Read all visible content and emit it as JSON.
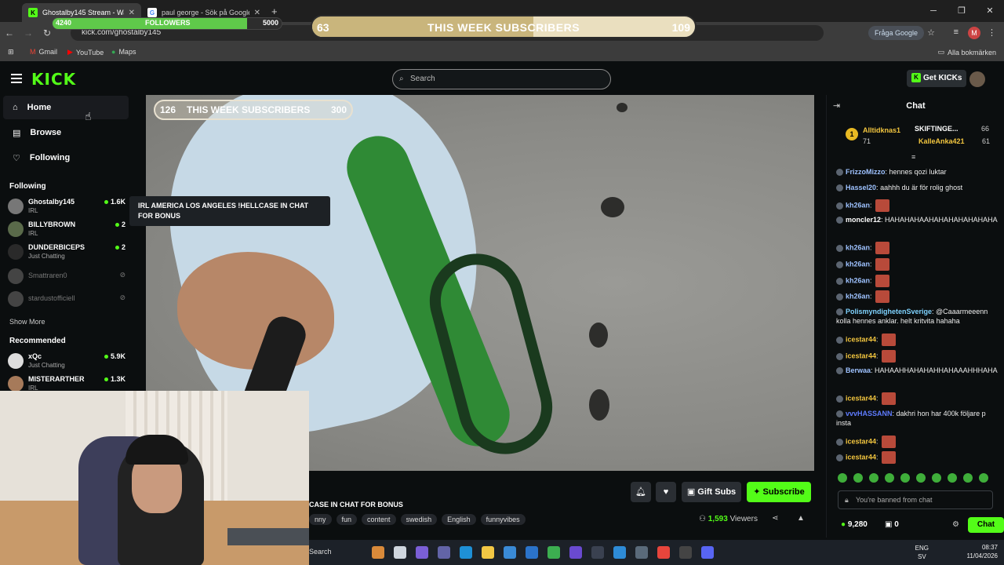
{
  "browser": {
    "tabs": [
      {
        "title": "Ghostalby145 Stream - Wat",
        "active": true
      },
      {
        "title": "paul george - Sök på Google",
        "active": false
      }
    ],
    "url": "kick.com/ghostalby145",
    "ask_google": "Fråga Google",
    "profile_initial": "M",
    "bookmarks": [
      "Gmail",
      "YouTube",
      "Maps"
    ],
    "all_bookmarks": "Alla bokmärken"
  },
  "overlay": {
    "followers": {
      "current": "4240",
      "label": "FOLLOWERS",
      "goal": "5000",
      "progress": 0.848
    },
    "subs_top": {
      "current": "63",
      "label": "THIS WEEK SUBSCRIBERS",
      "goal": "109",
      "progress": 0.578
    },
    "subs_video": {
      "current": "126",
      "label": "THIS WEEK SUBSCRIBERS",
      "goal": "300"
    }
  },
  "header": {
    "logo": "KICK",
    "search_placeholder": "Search",
    "get_kicks": "Get KICKs"
  },
  "sidebar": {
    "nav": [
      {
        "label": "Home",
        "icon": "home-icon"
      },
      {
        "label": "Browse",
        "icon": "browse-icon"
      },
      {
        "label": "Following",
        "icon": "heart-icon"
      }
    ],
    "following_heading": "Following",
    "following": [
      {
        "name": "Ghostalby145",
        "category": "IRL",
        "viewers": "1.6K",
        "live": true
      },
      {
        "name": "BILLYBROWN",
        "category": "IRL",
        "viewers": "2",
        "live": true
      },
      {
        "name": "DUNDERBICEPS",
        "category": "Just Chatting",
        "viewers": "2",
        "live": true
      },
      {
        "name": "Smattraren0",
        "category": "",
        "viewers": "",
        "live": false
      },
      {
        "name": "stardustofficiell",
        "category": "",
        "viewers": "",
        "live": false
      }
    ],
    "show_more": "Show More",
    "recommended_heading": "Recommended",
    "recommended": [
      {
        "name": "xQc",
        "category": "Just Chatting",
        "viewers": "5.9K"
      },
      {
        "name": "MISTERARTHER",
        "category": "IRL",
        "viewers": "1.3K"
      }
    ],
    "tooltip": "IRL AMERICA LOS ANGELES !HELLCASE IN CHAT FOR BONUS"
  },
  "stream": {
    "title_visible": "CASE IN CHAT FOR BONUS",
    "tags": [
      "nny",
      "fun",
      "content",
      "swedish",
      "English",
      "funnyvibes"
    ],
    "gift_subs": "Gift Subs",
    "subscribe": "Subscribe",
    "viewers": "1,593",
    "viewers_label": "Viewers"
  },
  "chat": {
    "title": "Chat",
    "leaderboard": [
      {
        "rank": "1",
        "name": "Alltidknas1",
        "value": "71"
      },
      {
        "name": "SKIFTINGE...",
        "value": "66"
      },
      {
        "name": "KalleAnka421",
        "value": "61"
      }
    ],
    "messages": [
      {
        "user": "FrizzoMizzo",
        "text": "hennes qozi luktar",
        "color": "#9ec2ff"
      },
      {
        "user": "Hassel20",
        "text": "aahhh du är för rolig ghost",
        "color": "#9ec2ff"
      },
      {
        "user": "kh26an",
        "text": "",
        "color": "#9ec2ff"
      },
      {
        "user": "moncler12",
        "text": "HAHAHAHAAHAHAHAHAHAHAHA",
        "color": "#ffffff"
      },
      {
        "user": "kh26an",
        "text": "",
        "color": "#9ec2ff"
      },
      {
        "user": "kh26an",
        "text": "",
        "color": "#9ec2ff"
      },
      {
        "user": "kh26an",
        "text": "",
        "color": "#9ec2ff"
      },
      {
        "user": "kh26an",
        "text": "",
        "color": "#9ec2ff"
      },
      {
        "user": "PolismyndighetenSverige",
        "text": "@Caaarmeeenn kolla hennes anklar. helt kritvita hahaha",
        "color": "#7fd3ff"
      },
      {
        "user": "icestar44",
        "text": "",
        "color": "#f3c63f"
      },
      {
        "user": "icestar44",
        "text": "",
        "color": "#f3c63f"
      },
      {
        "user": "Berwaa",
        "text": "HAHAAHHAHAHAHHAHAAAHHHAHA",
        "color": "#9ec2ff"
      },
      {
        "user": "icestar44",
        "text": "",
        "color": "#f3c63f"
      },
      {
        "user": "vvvHASSANN",
        "text": "dakhri hon har 400k följare p insta",
        "color": "#5f7cff"
      },
      {
        "user": "icestar44",
        "text": "",
        "color": "#f3c63f"
      },
      {
        "user": "icestar44",
        "text": "",
        "color": "#f3c63f"
      }
    ],
    "banned": "You're banned from chat",
    "kicks": "9,280",
    "gifts": "0",
    "chat_button": "Chat"
  },
  "taskbar": {
    "search": "Search",
    "lang": "ENG",
    "lang2": "SV",
    "time": "08:37",
    "date": "11/04/2026"
  },
  "colors": {
    "accent": "#53fc18",
    "gold": "#f3c63f"
  }
}
